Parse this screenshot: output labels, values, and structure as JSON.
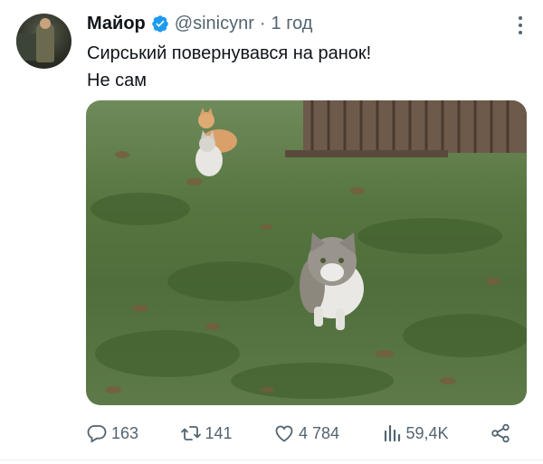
{
  "author": {
    "name": "Майор",
    "handle": "@sinicynr",
    "separator": "·",
    "time": "1 год",
    "verified": true,
    "avatar_icon": "avatar-photo"
  },
  "tweet": {
    "line1": "Сирський повернувався на ранок!",
    "line2": "Не сам"
  },
  "media": {
    "description_icon": "photo-cats-on-grass"
  },
  "actions": {
    "replies": "163",
    "reposts": "141",
    "likes": "4 784",
    "views": "59,4K"
  },
  "colors": {
    "text": "#0f1419",
    "secondary": "#536471",
    "verified": "#1d9bf0"
  }
}
